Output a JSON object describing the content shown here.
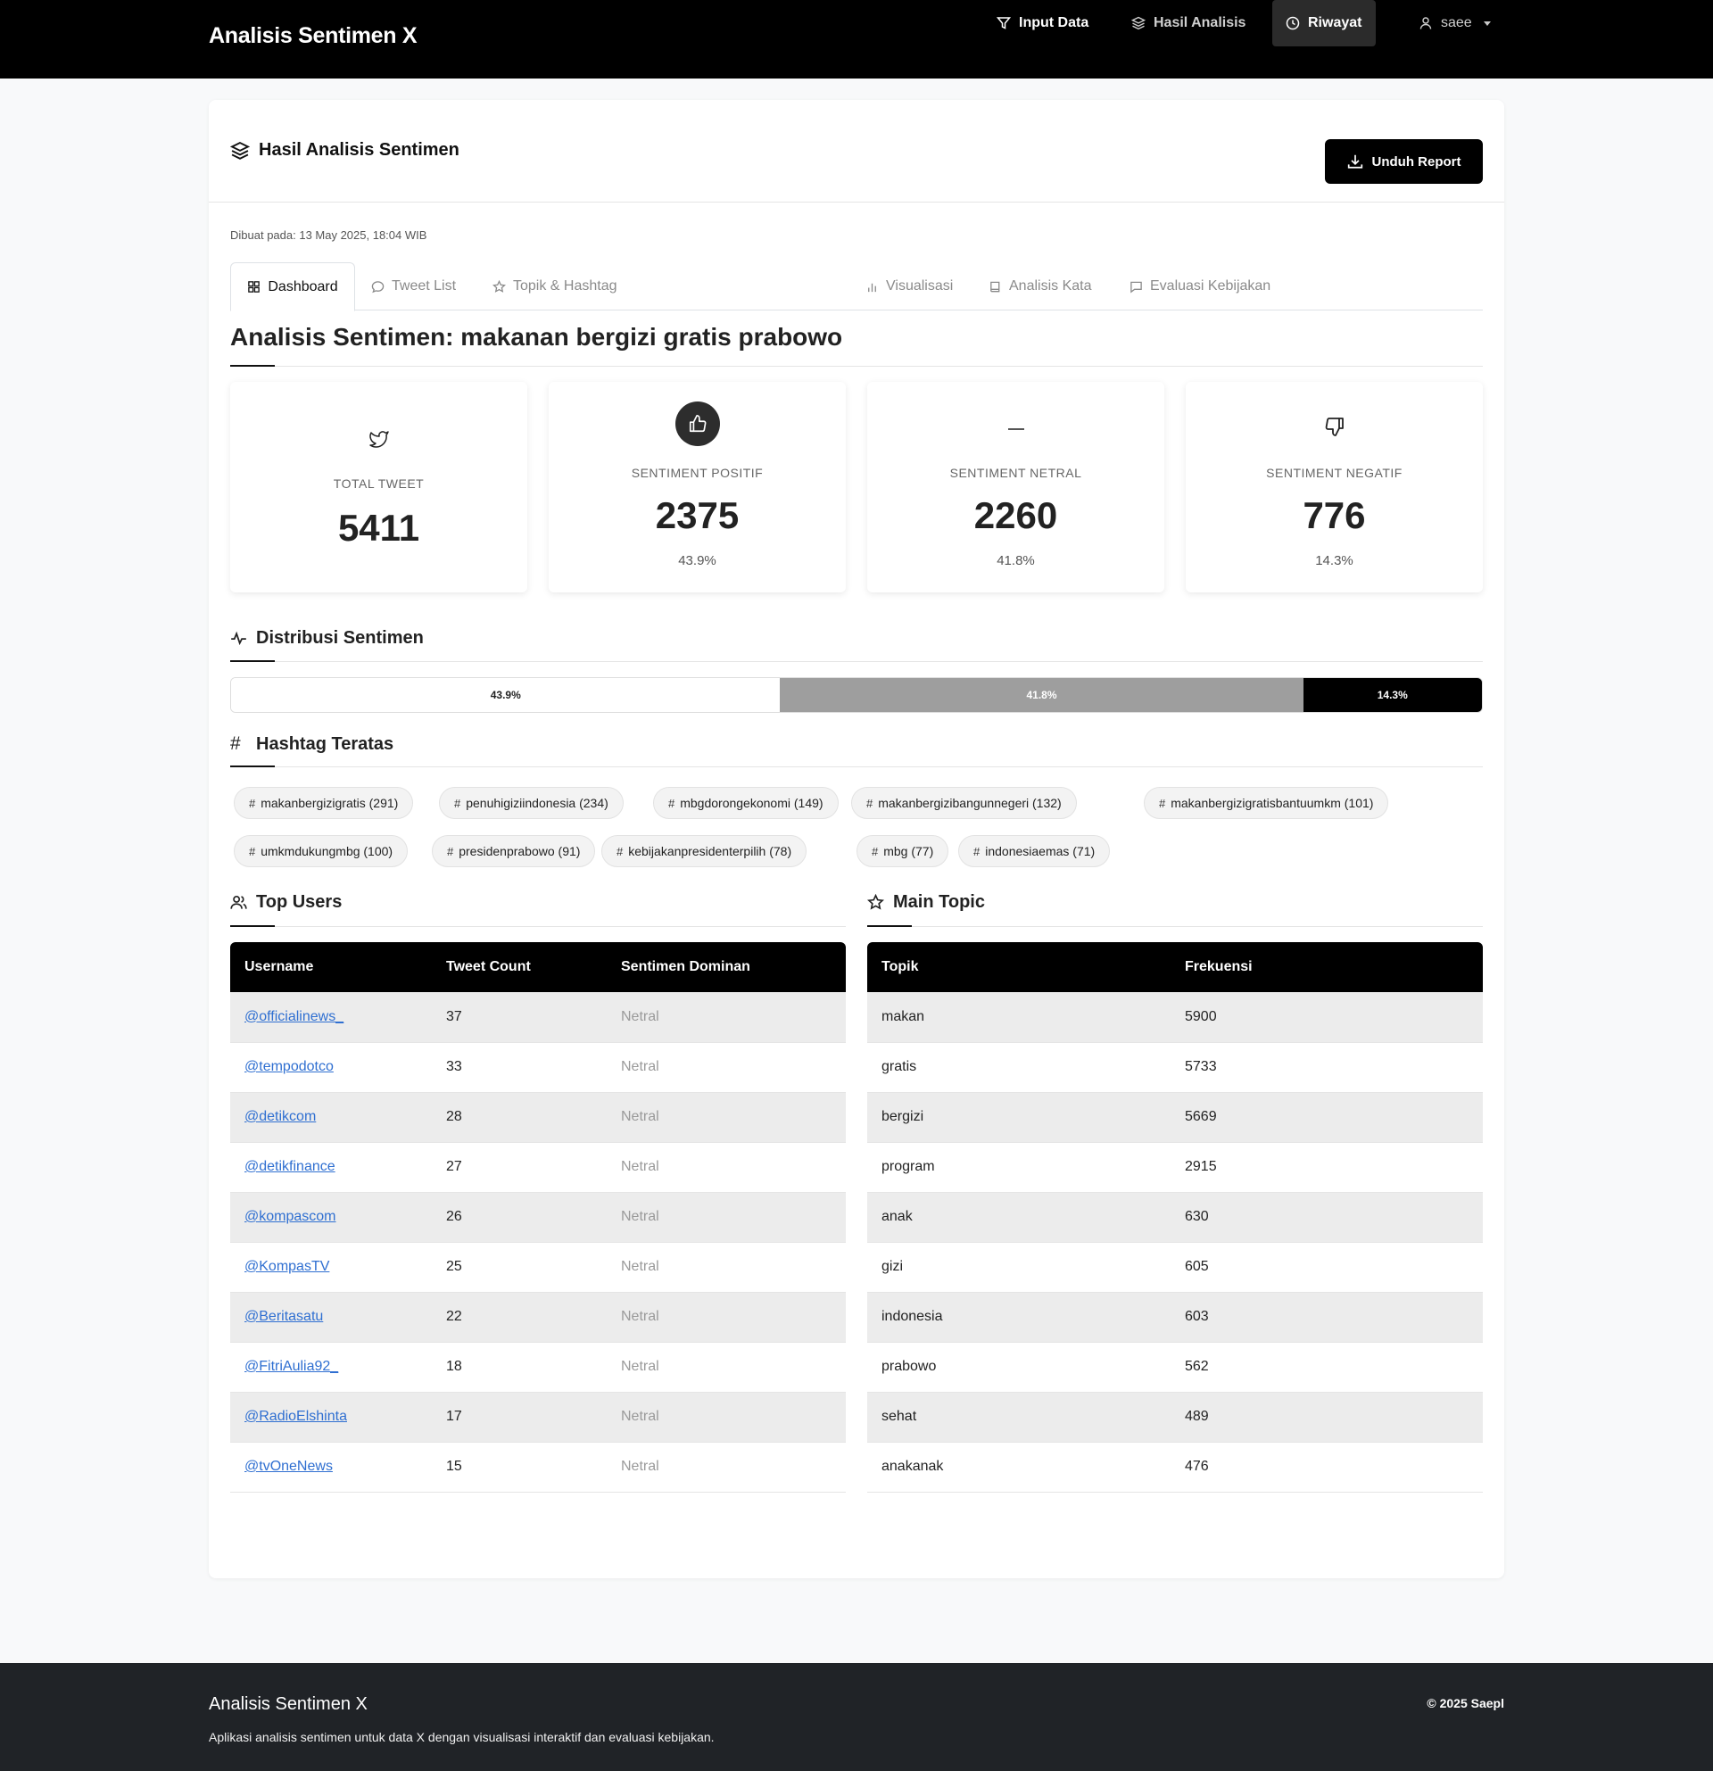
{
  "app": {
    "brand": "Analisis Sentimen X"
  },
  "nav": {
    "input_data": "Input Data",
    "hasil_analisis": "Hasil Analisis",
    "riwayat": "Riwayat",
    "user": "saee"
  },
  "card": {
    "title": "Hasil Analisis Sentimen",
    "download": "Unduh Report",
    "created": "Dibuat pada: 13 May 2025, 18:04 WIB"
  },
  "tabs": [
    "Dashboard",
    "Tweet List",
    "Topik & Hashtag",
    "Visualisasi",
    "Analisis Kata",
    "Evaluasi Kebijakan"
  ],
  "heading": "Analisis Sentimen: makanan bergizi gratis prabowo",
  "stats": {
    "total": {
      "label": "TOTAL TWEET",
      "value": "5411"
    },
    "positif": {
      "label": "SENTIMENT POSITIF",
      "value": "2375",
      "pct": "43.9%"
    },
    "netral": {
      "label": "SENTIMENT NETRAL",
      "value": "2260",
      "pct": "41.8%"
    },
    "negatif": {
      "label": "SENTIMENT NEGATIF",
      "value": "776",
      "pct": "14.3%"
    }
  },
  "distribution": {
    "title": "Distribusi Sentimen",
    "positif": "43.9%",
    "netral": "41.8%",
    "negatif": "14.3%",
    "fractions": {
      "positif": 0.439,
      "netral": 0.418,
      "negatif": 0.143
    },
    "colors": {
      "positif": "#ffffff",
      "netral": "#9e9e9e",
      "negatif": "#000000"
    }
  },
  "hashtags": {
    "title": "Hashtag Teratas",
    "items": [
      "makanbergizigratis (291)",
      "penuhigiziindonesia (234)",
      "mbgdorongekonomi (149)",
      "makanbergizibangunnegeri (132)",
      "makanbergizigratisbantuumkm (101)",
      "umkmdukungmbg (100)",
      "presidenprabowo (91)",
      "kebijakanpresidenterpilih (78)",
      "mbg (77)",
      "indonesiaemas (71)"
    ]
  },
  "top_users": {
    "title": "Top Users",
    "headers": [
      "Username",
      "Tweet Count",
      "Sentimen Dominan"
    ],
    "rows": [
      [
        "@officialinews_",
        "37",
        "Netral"
      ],
      [
        "@tempodotco",
        "33",
        "Netral"
      ],
      [
        "@detikcom",
        "28",
        "Netral"
      ],
      [
        "@detikfinance",
        "27",
        "Netral"
      ],
      [
        "@kompascom",
        "26",
        "Netral"
      ],
      [
        "@KompasTV",
        "25",
        "Netral"
      ],
      [
        "@Beritasatu",
        "22",
        "Netral"
      ],
      [
        "@FitriAulia92_",
        "18",
        "Netral"
      ],
      [
        "@RadioElshinta",
        "17",
        "Netral"
      ],
      [
        "@tvOneNews",
        "15",
        "Netral"
      ]
    ]
  },
  "main_topic": {
    "title": "Main Topic",
    "headers": [
      "Topik",
      "Frekuensi"
    ],
    "rows": [
      [
        "makan",
        "5900"
      ],
      [
        "gratis",
        "5733"
      ],
      [
        "bergizi",
        "5669"
      ],
      [
        "program",
        "2915"
      ],
      [
        "anak",
        "630"
      ],
      [
        "gizi",
        "605"
      ],
      [
        "indonesia",
        "603"
      ],
      [
        "prabowo",
        "562"
      ],
      [
        "sehat",
        "489"
      ],
      [
        "anakanak",
        "476"
      ]
    ]
  },
  "footer": {
    "title": "Analisis Sentimen X",
    "desc": "Aplikasi analisis sentimen untuk data X dengan visualisasi interaktif dan evaluasi kebijakan.",
    "copy": "© 2025 Saepl"
  }
}
